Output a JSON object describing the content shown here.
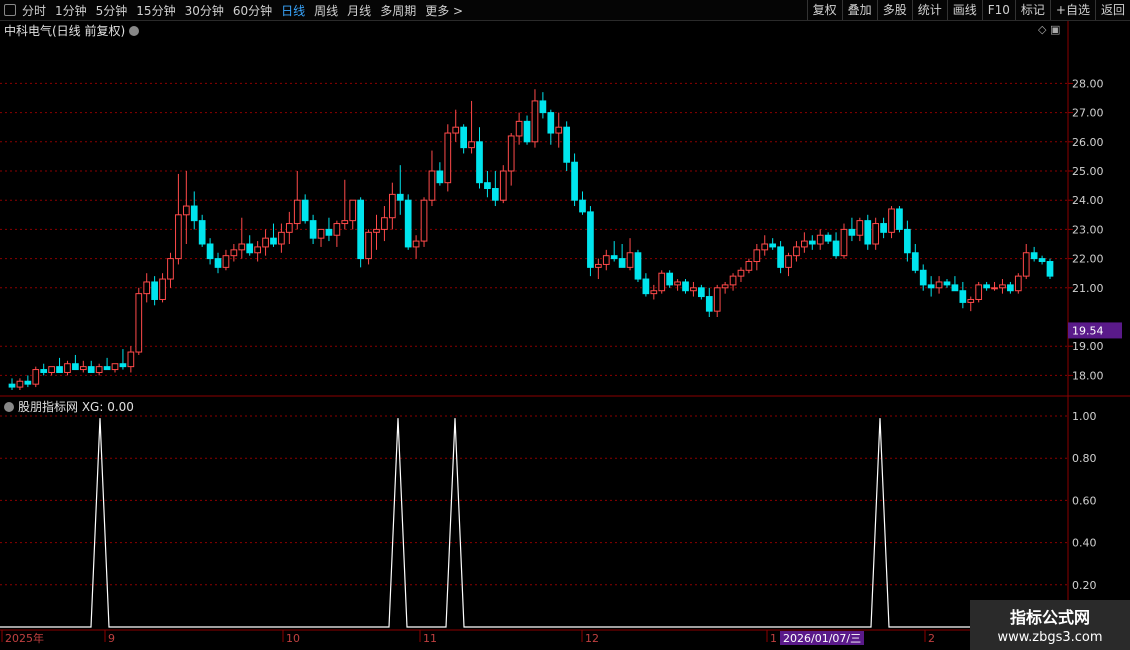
{
  "toolbar": {
    "periods": [
      "分时",
      "1分钟",
      "5分钟",
      "15分钟",
      "30分钟",
      "60分钟",
      "日线",
      "周线",
      "月线",
      "多周期",
      "更多 >"
    ],
    "active_period": "日线",
    "right_buttons": [
      "复权",
      "叠加",
      "多股",
      "统计",
      "画线",
      "F10",
      "标记",
      "+自选",
      "返回"
    ]
  },
  "main_chart": {
    "title": "中科电气(日线 前复权)",
    "price_ticks": [
      "28.00",
      "27.00",
      "26.00",
      "25.00",
      "24.00",
      "23.00",
      "22.00",
      "21.00",
      "19.00",
      "18.00"
    ],
    "current_price_label": "19.54"
  },
  "indicator": {
    "title": "股朋指标网 XG: 0.00",
    "ticks": [
      "1.00",
      "0.80",
      "0.60",
      "0.40",
      "0.20"
    ]
  },
  "date_axis": {
    "labels": [
      "2025年",
      "9",
      "10",
      "11",
      "12",
      "1",
      "2"
    ],
    "highlight": "2026/01/07/三"
  },
  "watermark": {
    "line1": "指标公式网",
    "line2": "www.zbgs3.com"
  },
  "colors": {
    "up": "#ff4a4a",
    "down": "#00e5ee",
    "grid": "#8b0000",
    "accent": "#3aa7ff",
    "highlight_bg": "#5a1a8a"
  },
  "chart_data": {
    "type": "candlestick",
    "ylim": [
      17.5,
      28.8
    ],
    "signal_peaks": [
      0.99,
      0.99,
      0.99,
      0.99
    ],
    "candles": [
      [
        17.7,
        17.9,
        17.5,
        17.6
      ],
      [
        17.6,
        17.9,
        17.5,
        17.8
      ],
      [
        17.8,
        18.0,
        17.6,
        17.7
      ],
      [
        17.7,
        18.3,
        17.6,
        18.2
      ],
      [
        18.2,
        18.4,
        18.0,
        18.1
      ],
      [
        18.1,
        18.3,
        18.0,
        18.3
      ],
      [
        18.3,
        18.6,
        18.1,
        18.1
      ],
      [
        18.1,
        18.5,
        18.0,
        18.4
      ],
      [
        18.4,
        18.7,
        18.2,
        18.2
      ],
      [
        18.2,
        18.5,
        18.1,
        18.3
      ],
      [
        18.3,
        18.5,
        18.1,
        18.1
      ],
      [
        18.1,
        18.4,
        18.0,
        18.3
      ],
      [
        18.3,
        18.6,
        18.2,
        18.2
      ],
      [
        18.2,
        18.4,
        18.1,
        18.4
      ],
      [
        18.4,
        18.9,
        18.2,
        18.3
      ],
      [
        18.3,
        19.0,
        18.1,
        18.8
      ],
      [
        18.8,
        21.0,
        18.7,
        20.8
      ],
      [
        20.8,
        21.5,
        20.5,
        21.2
      ],
      [
        21.2,
        21.4,
        20.4,
        20.6
      ],
      [
        20.6,
        21.5,
        20.5,
        21.3
      ],
      [
        21.3,
        22.2,
        21.0,
        22.0
      ],
      [
        22.0,
        24.9,
        21.8,
        23.5
      ],
      [
        23.5,
        25.0,
        22.5,
        23.8
      ],
      [
        23.8,
        24.3,
        23.0,
        23.3
      ],
      [
        23.3,
        23.5,
        22.4,
        22.5
      ],
      [
        22.5,
        22.7,
        21.8,
        22.0
      ],
      [
        22.0,
        22.2,
        21.5,
        21.7
      ],
      [
        21.7,
        22.3,
        21.6,
        22.1
      ],
      [
        22.1,
        22.5,
        21.9,
        22.3
      ],
      [
        22.3,
        23.4,
        22.0,
        22.5
      ],
      [
        22.5,
        22.8,
        22.1,
        22.2
      ],
      [
        22.2,
        22.6,
        21.9,
        22.4
      ],
      [
        22.4,
        23.0,
        22.1,
        22.7
      ],
      [
        22.7,
        23.2,
        22.4,
        22.5
      ],
      [
        22.5,
        23.2,
        22.2,
        22.9
      ],
      [
        22.9,
        23.6,
        22.5,
        23.2
      ],
      [
        23.2,
        25.0,
        23.0,
        24.0
      ],
      [
        24.0,
        24.2,
        23.2,
        23.3
      ],
      [
        23.3,
        23.5,
        22.5,
        22.7
      ],
      [
        22.7,
        23.0,
        22.4,
        23.0
      ],
      [
        23.0,
        23.4,
        22.6,
        22.8
      ],
      [
        22.8,
        23.3,
        22.4,
        23.2
      ],
      [
        23.2,
        24.7,
        23.0,
        23.3
      ],
      [
        23.3,
        24.0,
        23.0,
        24.0
      ],
      [
        24.0,
        24.1,
        21.7,
        22.0
      ],
      [
        22.0,
        23.0,
        21.8,
        22.9
      ],
      [
        22.9,
        23.5,
        22.3,
        23.0
      ],
      [
        23.0,
        23.8,
        22.6,
        23.4
      ],
      [
        23.4,
        24.6,
        23.0,
        24.2
      ],
      [
        24.2,
        25.2,
        23.5,
        24.0
      ],
      [
        24.0,
        24.2,
        22.3,
        22.4
      ],
      [
        22.4,
        22.8,
        22.0,
        22.6
      ],
      [
        22.6,
        24.1,
        22.4,
        24.0
      ],
      [
        24.0,
        25.7,
        23.8,
        25.0
      ],
      [
        25.0,
        25.3,
        24.5,
        24.6
      ],
      [
        24.6,
        26.6,
        24.3,
        26.3
      ],
      [
        26.3,
        27.1,
        26.0,
        26.5
      ],
      [
        26.5,
        26.6,
        25.6,
        25.8
      ],
      [
        25.8,
        27.4,
        25.6,
        26.0
      ],
      [
        26.0,
        26.5,
        24.4,
        24.6
      ],
      [
        24.6,
        25.0,
        24.1,
        24.4
      ],
      [
        24.4,
        25.0,
        23.8,
        24.0
      ],
      [
        24.0,
        25.2,
        23.9,
        25.0
      ],
      [
        25.0,
        26.3,
        24.5,
        26.2
      ],
      [
        26.2,
        27.0,
        25.9,
        26.7
      ],
      [
        26.7,
        26.9,
        25.9,
        26.0
      ],
      [
        26.0,
        27.8,
        25.8,
        27.4
      ],
      [
        27.4,
        27.7,
        26.8,
        27.0
      ],
      [
        27.0,
        27.1,
        25.9,
        26.3
      ],
      [
        26.3,
        27.0,
        25.8,
        26.5
      ],
      [
        26.5,
        26.7,
        25.0,
        25.3
      ],
      [
        25.3,
        25.6,
        23.8,
        24.0
      ],
      [
        24.0,
        24.3,
        23.5,
        23.6
      ],
      [
        23.6,
        23.8,
        21.4,
        21.7
      ],
      [
        21.7,
        22.0,
        21.3,
        21.8
      ],
      [
        21.8,
        22.3,
        21.6,
        22.1
      ],
      [
        22.1,
        22.6,
        21.9,
        22.0
      ],
      [
        22.0,
        22.5,
        21.7,
        21.7
      ],
      [
        21.7,
        22.7,
        21.6,
        22.2
      ],
      [
        22.2,
        22.3,
        21.2,
        21.3
      ],
      [
        21.3,
        21.5,
        20.7,
        20.8
      ],
      [
        20.8,
        21.1,
        20.6,
        20.9
      ],
      [
        20.9,
        21.6,
        20.8,
        21.5
      ],
      [
        21.5,
        21.6,
        21.0,
        21.1
      ],
      [
        21.1,
        21.3,
        20.9,
        21.2
      ],
      [
        21.2,
        21.3,
        20.8,
        20.9
      ],
      [
        20.9,
        21.2,
        20.7,
        21.0
      ],
      [
        21.0,
        21.1,
        20.6,
        20.7
      ],
      [
        20.7,
        21.0,
        20.0,
        20.2
      ],
      [
        20.2,
        21.1,
        20.0,
        21.0
      ],
      [
        21.0,
        21.2,
        20.8,
        21.1
      ],
      [
        21.1,
        21.5,
        20.9,
        21.4
      ],
      [
        21.4,
        21.7,
        21.2,
        21.6
      ],
      [
        21.6,
        22.0,
        21.5,
        21.9
      ],
      [
        21.9,
        22.5,
        21.6,
        22.3
      ],
      [
        22.3,
        22.8,
        22.1,
        22.5
      ],
      [
        22.5,
        22.7,
        22.3,
        22.4
      ],
      [
        22.4,
        22.6,
        21.5,
        21.7
      ],
      [
        21.7,
        22.2,
        21.4,
        22.1
      ],
      [
        22.1,
        22.6,
        21.9,
        22.4
      ],
      [
        22.4,
        22.9,
        22.2,
        22.6
      ],
      [
        22.6,
        22.8,
        22.3,
        22.5
      ],
      [
        22.5,
        23.0,
        22.3,
        22.8
      ],
      [
        22.8,
        22.9,
        22.5,
        22.6
      ],
      [
        22.6,
        22.9,
        22.0,
        22.1
      ],
      [
        22.1,
        23.2,
        22.0,
        23.0
      ],
      [
        23.0,
        23.4,
        22.6,
        22.8
      ],
      [
        22.8,
        23.4,
        22.6,
        23.3
      ],
      [
        23.3,
        23.5,
        22.3,
        22.5
      ],
      [
        22.5,
        23.4,
        22.3,
        23.2
      ],
      [
        23.2,
        23.4,
        22.7,
        22.9
      ],
      [
        22.9,
        23.8,
        22.7,
        23.7
      ],
      [
        23.7,
        23.8,
        22.9,
        23.0
      ],
      [
        23.0,
        23.3,
        21.9,
        22.2
      ],
      [
        22.2,
        22.5,
        21.5,
        21.6
      ],
      [
        21.6,
        21.8,
        20.9,
        21.1
      ],
      [
        21.1,
        21.4,
        20.7,
        21.0
      ],
      [
        21.0,
        21.4,
        20.8,
        21.2
      ],
      [
        21.2,
        21.3,
        21.0,
        21.1
      ],
      [
        21.1,
        21.4,
        20.9,
        20.9
      ],
      [
        20.9,
        21.2,
        20.3,
        20.5
      ],
      [
        20.5,
        20.7,
        20.2,
        20.6
      ],
      [
        20.6,
        21.2,
        20.5,
        21.1
      ],
      [
        21.1,
        21.2,
        20.9,
        21.0
      ],
      [
        21.0,
        21.2,
        20.9,
        21.0
      ],
      [
        21.0,
        21.3,
        20.8,
        21.1
      ],
      [
        21.1,
        21.2,
        20.8,
        20.9
      ],
      [
        20.9,
        21.5,
        20.8,
        21.4
      ],
      [
        21.4,
        22.5,
        21.3,
        22.2
      ],
      [
        22.2,
        22.4,
        21.9,
        22.0
      ],
      [
        22.0,
        22.1,
        21.8,
        21.9
      ],
      [
        21.9,
        22.0,
        21.3,
        21.4
      ]
    ]
  }
}
